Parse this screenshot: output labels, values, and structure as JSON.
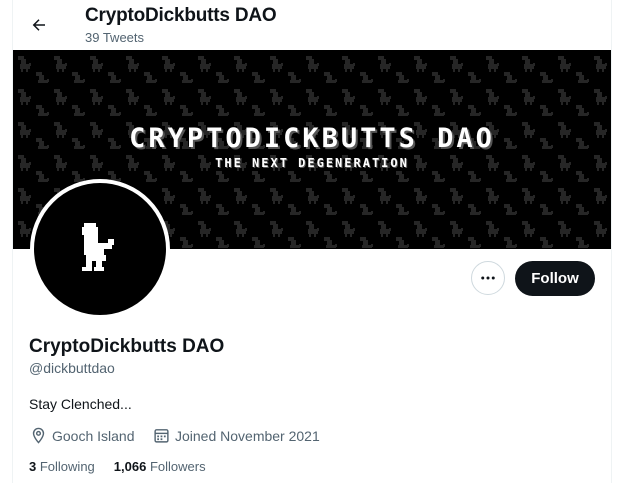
{
  "header": {
    "display_name": "CryptoDickbutts DAO",
    "tweet_count": "39 Tweets"
  },
  "banner": {
    "title": "CRYPTODICKBUTTS DAO",
    "subtitle": "THE NEXT DEGENERATION"
  },
  "actions": {
    "follow_label": "Follow"
  },
  "profile": {
    "name": "CryptoDickbutts DAO",
    "handle": "@dickbuttdao",
    "bio": "Stay Clenched...",
    "location": "Gooch Island",
    "joined": "Joined November 2021"
  },
  "stats": {
    "following_count": "3",
    "following_label": "Following",
    "followers_count": "1,066",
    "followers_label": "Followers"
  },
  "icons": {
    "back": "arrow-left-icon",
    "more": "ellipsis-icon",
    "location": "location-pin-icon",
    "calendar": "calendar-icon"
  },
  "colors": {
    "text_primary": "#0f1419",
    "text_secondary": "#536471",
    "button_dark": "#0f1419",
    "border": "#cfd9de",
    "banner_bg": "#000000"
  }
}
